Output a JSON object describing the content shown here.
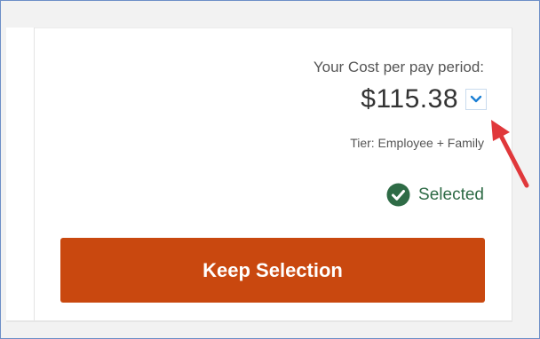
{
  "cost": {
    "label": "Your Cost per pay period:",
    "amount": "$115.38",
    "dropdown_icon": "chevron-down-icon"
  },
  "tier": {
    "text": "Tier: Employee + Family"
  },
  "status": {
    "icon": "check-circle-icon",
    "text": "Selected"
  },
  "action": {
    "keep_label": "Keep Selection"
  },
  "colors": {
    "button": "#c9480f",
    "selected": "#2e6b46",
    "chevron": "#1b7fd4",
    "annotation_arrow": "#e0383b"
  }
}
